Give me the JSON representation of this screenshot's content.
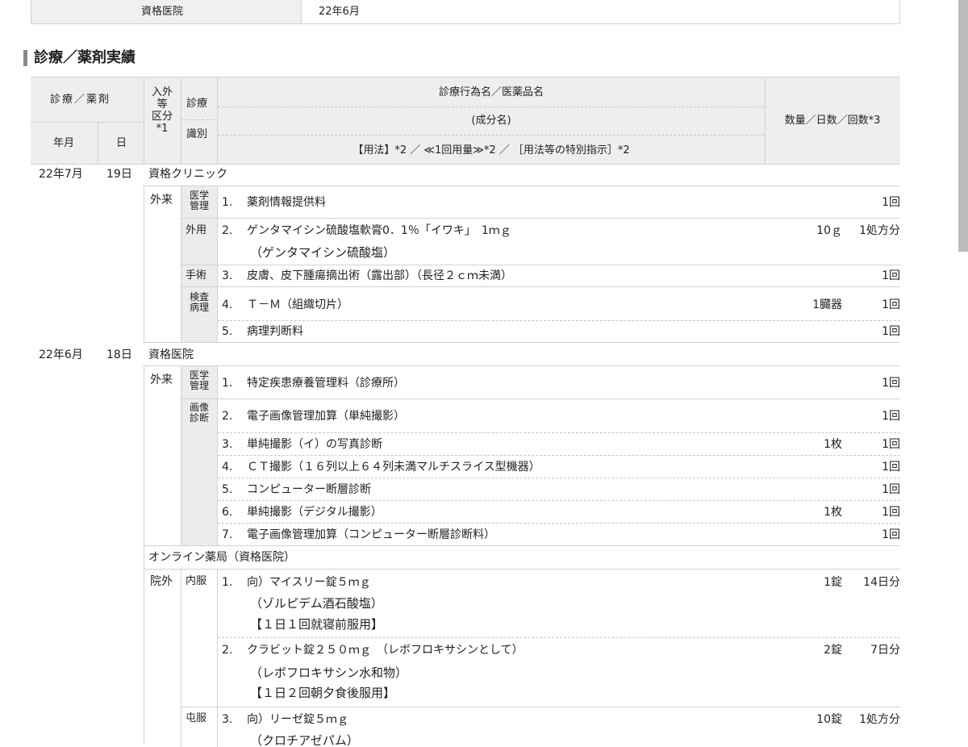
{
  "top_row": {
    "label": "資格医院",
    "value": "22年6月"
  },
  "section_title": "診療／薬剤実績",
  "headers": {
    "shinryo_yakuzai": "診療／薬剤",
    "nyugai": "入外\n等\n区分\n*1",
    "shinryo": "診療",
    "shikibetsu": "識別",
    "nengetsu": "年月",
    "hi": "日",
    "name_line1": "診療行為名／医薬品名",
    "name_line2": "(成分名)",
    "name_line3": "【用法】*2 ／ ≪1回用量≫*2 ／ ［用法等の特別指示］*2",
    "quantity": "数量／日数／回数*3"
  },
  "groups": [
    {
      "ym": "22年7月",
      "day": "19日",
      "facility": "資格クリニック",
      "nyugai": "外来",
      "categories": [
        {
          "label": "医学\n管理"
        },
        {
          "label": "外用"
        },
        {
          "label": "手術"
        },
        {
          "label": "検査\n病理"
        }
      ],
      "items": [
        {
          "num": "1.",
          "name": "薬剤情報提供料",
          "sub": "",
          "qty": "",
          "count": "1回"
        },
        {
          "num": "2.",
          "name": "ゲンタマイシン硫酸塩軟膏0．1％「イワキ」　1ｍｇ",
          "sub": "（ゲンタマイシン硫酸塩）",
          "qty": "10ｇ",
          "count": "1処方分"
        },
        {
          "num": "3.",
          "name": "皮膚、皮下腫瘍摘出術（露出部）（長径２ｃｍ未満）",
          "sub": "",
          "qty": "",
          "count": "1回"
        },
        {
          "num": "4.",
          "name": "Ｔ－Ｍ（組織切片）",
          "sub": "",
          "qty": "1臓器",
          "count": "1回"
        },
        {
          "num": "5.",
          "name": "病理判断料",
          "sub": "",
          "qty": "",
          "count": "1回"
        }
      ]
    },
    {
      "ym": "22年6月",
      "day": "18日",
      "facility": "資格医院",
      "nyugai": "外来",
      "categories": [
        {
          "label": "医学\n管理"
        },
        {
          "label": "画像\n診断"
        }
      ],
      "items": [
        {
          "num": "1.",
          "name": "特定疾患療養管理料（診療所）",
          "qty": "",
          "count": "1回"
        },
        {
          "num": "2.",
          "name": "電子画像管理加算（単純撮影）",
          "qty": "",
          "count": "1回"
        },
        {
          "num": "3.",
          "name": "単純撮影（イ）の写真診断",
          "qty": "1枚",
          "count": "1回"
        },
        {
          "num": "4.",
          "name": "ＣＴ撮影（１６列以上６４列未満マルチスライス型機器）",
          "qty": "",
          "count": "1回"
        },
        {
          "num": "5.",
          "name": "コンピューター断層診断",
          "qty": "",
          "count": "1回"
        },
        {
          "num": "6.",
          "name": "単純撮影（デジタル撮影）",
          "qty": "1枚",
          "count": "1回"
        },
        {
          "num": "7.",
          "name": "電子画像管理加算（コンピューター断層診断料）",
          "qty": "",
          "count": "1回"
        }
      ]
    }
  ],
  "pharmacy": {
    "facility": "オンライン薬局（資格医院）",
    "nyugai": "院外",
    "categories": [
      {
        "label": "内服"
      },
      {
        "label": "屯服"
      }
    ],
    "items": [
      {
        "num": "1.",
        "name": "向）マイスリー錠５ｍｇ",
        "sub": "（ゾルピデム酒石酸塩）",
        "usage": "【１日１回就寝前服用】",
        "qty": "1錠",
        "count": "14日分"
      },
      {
        "num": "2.",
        "name": "クラビット錠２５０ｍｇ　（レボフロキサシンとして）",
        "sub": "（レボフロキサシン水和物）",
        "usage": "【１日２回朝夕食後服用】",
        "qty": "2錠",
        "count": "7日分"
      },
      {
        "num": "3.",
        "name": "向）リーゼ錠５ｍｇ",
        "sub": "（クロチアゼパム）",
        "usage": "",
        "qty": "10錠",
        "count": "1処方分"
      }
    ]
  }
}
